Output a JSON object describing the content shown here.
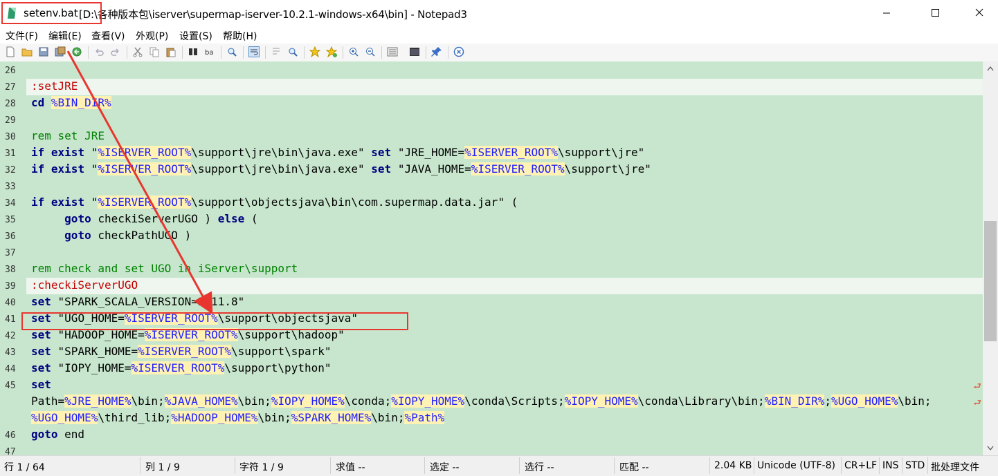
{
  "window": {
    "filename": "setenv.bat",
    "path_title": "[D:\\各种版本包\\iserver\\supermap-iserver-10.2.1-windows-x64\\bin] - Notepad3"
  },
  "menu": [
    "文件(F)",
    "编辑(E)",
    "查看(V)",
    "外观(P)",
    "设置(S)",
    "帮助(H)"
  ],
  "toolbar_icons": [
    "new-file-icon",
    "open-folder-icon",
    "save-icon",
    "save-as-icon",
    "revert-icon",
    "undo-icon",
    "redo-icon",
    "cut-icon",
    "copy-icon",
    "paste-icon",
    "find-icon",
    "replace-icon",
    "find-in-files-icon",
    "word-wrap-icon",
    "wrap-settings-icon",
    "zoom-lens-icon",
    "favorites-icon",
    "add-favorite-icon",
    "zoom-in-icon",
    "zoom-out-icon",
    "schema-icon",
    "terminal-icon",
    "pin-icon",
    "close-circle-icon"
  ],
  "editor": {
    "lines": [
      {
        "num": "26",
        "text": ""
      },
      {
        "num": "27",
        "text": ":setJRE"
      },
      {
        "num": "28",
        "text": "cd %BIN_DIR%"
      },
      {
        "num": "29",
        "text": ""
      },
      {
        "num": "30",
        "text": "rem set JRE"
      },
      {
        "num": "31",
        "text": "if exist \"%ISERVER_ROOT%\\support\\jre\\bin\\java.exe\" set \"JRE_HOME=%ISERVER_ROOT%\\support\\jre\""
      },
      {
        "num": "32",
        "text": "if exist \"%ISERVER_ROOT%\\support\\jre\\bin\\java.exe\" set \"JAVA_HOME=%ISERVER_ROOT%\\support\\jre\""
      },
      {
        "num": "33",
        "text": ""
      },
      {
        "num": "34",
        "text": "if exist \"%ISERVER_ROOT%\\support\\objectsjava\\bin\\com.supermap.data.jar\" ("
      },
      {
        "num": "35",
        "text": "     goto checkiServerUGO ) else ("
      },
      {
        "num": "36",
        "text": "     goto checkPathUGO )"
      },
      {
        "num": "37",
        "text": ""
      },
      {
        "num": "38",
        "text": "rem check and set UGO in iServer\\support"
      },
      {
        "num": "39",
        "text": ":checkiServerUGO"
      },
      {
        "num": "40",
        "text": "set \"SPARK_SCALA_VERSION=2.11.8\""
      },
      {
        "num": "41",
        "text": "set \"UGO_HOME=%ISERVER_ROOT%\\support\\objectsjava\""
      },
      {
        "num": "42",
        "text": "set \"HADOOP_HOME=%ISERVER_ROOT%\\support\\hadoop\""
      },
      {
        "num": "43",
        "text": "set \"SPARK_HOME=%ISERVER_ROOT%\\support\\spark\""
      },
      {
        "num": "44",
        "text": "set \"IOPY_HOME=%ISERVER_ROOT%\\support\\python\""
      },
      {
        "num": "45",
        "text": "set"
      },
      {
        "num": "",
        "text": "Path=%JRE_HOME%\\bin;%JAVA_HOME%\\bin;%IOPY_HOME%\\conda;%IOPY_HOME%\\conda\\Scripts;%IOPY_HOME%\\conda\\Library\\bin;%BIN_DIR%;%UGO_HOME%\\bin;"
      },
      {
        "num": "",
        "text": "%UGO_HOME%\\third_lib;%HADOOP_HOME%\\bin;%SPARK_HOME%\\bin;%Path%"
      },
      {
        "num": "46",
        "text": "goto end"
      },
      {
        "num": "47",
        "text": ""
      }
    ]
  },
  "status": {
    "line": "行 1 / 64",
    "col": "列 1 / 9",
    "char": "字符 1 / 9",
    "eval": "求值 --",
    "sel": "选定 --",
    "sel_lines": "选行 --",
    "match": "匹配 --",
    "size": "2.04 KB",
    "encoding": "Unicode (UTF-8)",
    "eol": "CR+LF",
    "ins": "INS",
    "std": "STD",
    "lexer": "批处理文件"
  },
  "colors": {
    "editor_bg": "#c7e6cd",
    "keyword": "#000080",
    "comment": "#008000",
    "label": "#c00000",
    "variable": "#2020ff",
    "variable_bg": "#fff2b3",
    "annotation_red": "#e8362f"
  }
}
